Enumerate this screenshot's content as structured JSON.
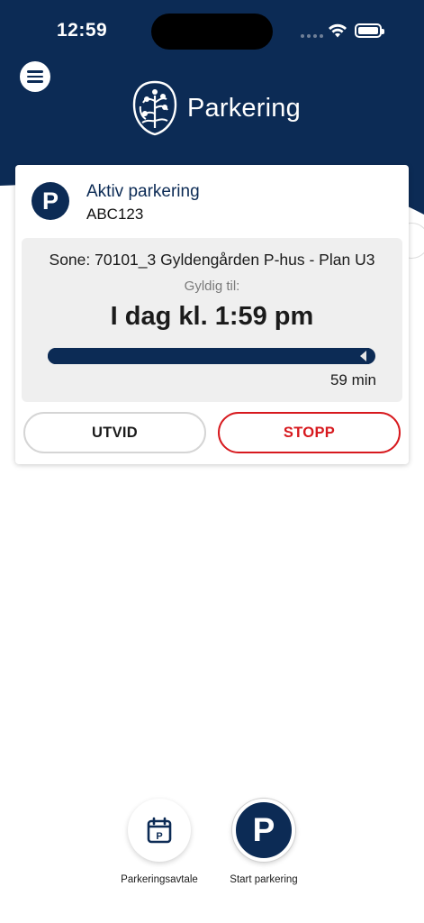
{
  "status_bar": {
    "time": "12:59"
  },
  "header": {
    "app_title": "Parkering",
    "menu_icon": "hamburger-menu-icon",
    "logo_icon": "oslo-city-seal-icon"
  },
  "active_parking": {
    "badge": "P",
    "title": "Aktiv parkering",
    "plate": "ABC123",
    "zone": "Sone: 70101_3 Gyldengården P-hus - Plan U3",
    "valid_label": "Gyldig til:",
    "valid_time": "I dag kl. 1:59 pm",
    "remaining": "59 min",
    "progress_remaining_fraction": 0.98,
    "extend_label": "UTVID",
    "stop_label": "STOPP"
  },
  "bottom_nav": {
    "agreement": {
      "label": "Parkeringsavtale",
      "icon": "calendar-parking-icon"
    },
    "start": {
      "label": "Start parkering",
      "glyph": "P"
    }
  },
  "colors": {
    "brand": "#0c2b55",
    "stop": "#d7191e",
    "panel": "#efefef"
  }
}
